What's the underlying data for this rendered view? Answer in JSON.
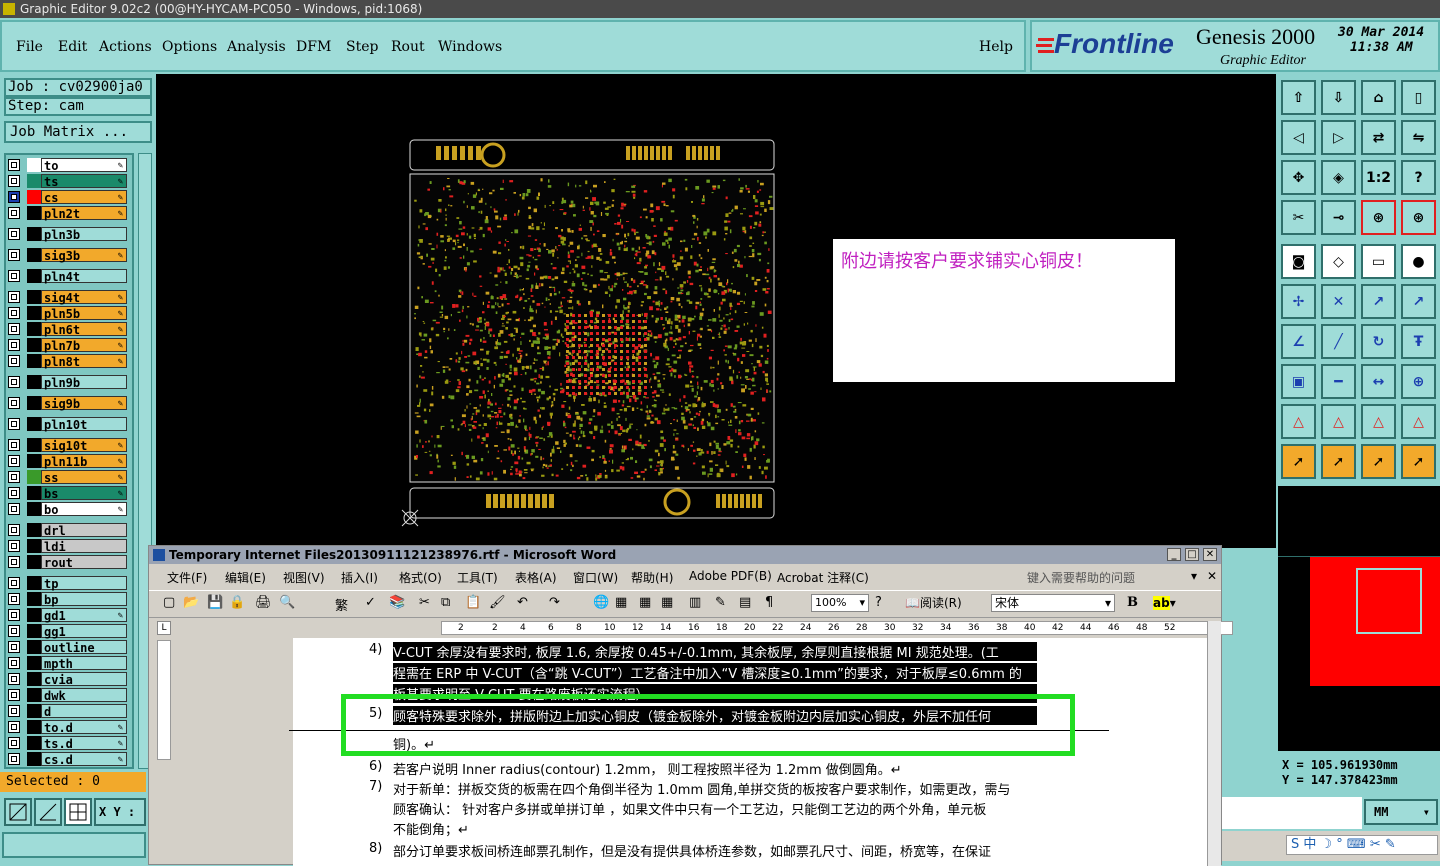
{
  "window": {
    "title": "Graphic Editor 9.02c2 (00@HY-HYCAM-PC050 - Windows, pid:1068)"
  },
  "menu": [
    "File",
    "Edit",
    "Actions",
    "Options",
    "Analysis",
    "DFM",
    "Step",
    "Rout",
    "Windows"
  ],
  "help": "Help",
  "brand": {
    "logo": "Frontline",
    "product": "Genesis 2000",
    "subtitle": "Graphic Editor",
    "date": "30 Mar 2014",
    "time": "11:38 AM"
  },
  "job": {
    "job_label": "Job : cv02900ja0",
    "step_label": "Step: cam",
    "matrix_button": "Job Matrix ..."
  },
  "layers": [
    {
      "name": "to",
      "color": "#ffffff",
      "name_bg": "#ffffff"
    },
    {
      "name": "ts",
      "color": "#1a8a6a",
      "name_bg": "#1a8a6a"
    },
    {
      "name": "cs",
      "color": "#ff0000",
      "name_bg": "#f2a92b",
      "active": true
    },
    {
      "name": "pln2t",
      "color": "#000000",
      "name_bg": "#f2a92b"
    },
    {
      "name": "pln3b",
      "color": "#000000",
      "name_bg": "#9fdcd8"
    },
    {
      "name": "sig3b",
      "color": "#000000",
      "name_bg": "#f2a92b"
    },
    {
      "name": "pln4t",
      "color": "#000000",
      "name_bg": "#9fdcd8"
    },
    {
      "name": "sig4t",
      "color": "#000000",
      "name_bg": "#f2a92b"
    },
    {
      "name": "pln5b",
      "color": "#000000",
      "name_bg": "#f2a92b"
    },
    {
      "name": "pln6t",
      "color": "#000000",
      "name_bg": "#f2a92b"
    },
    {
      "name": "pln7b",
      "color": "#000000",
      "name_bg": "#f2a92b"
    },
    {
      "name": "pln8t",
      "color": "#000000",
      "name_bg": "#f2a92b"
    },
    {
      "name": "pln9b",
      "color": "#000000",
      "name_bg": "#9fdcd8"
    },
    {
      "name": "sig9b",
      "color": "#000000",
      "name_bg": "#f2a92b"
    },
    {
      "name": "pln10t",
      "color": "#000000",
      "name_bg": "#9fdcd8"
    },
    {
      "name": "sig10t",
      "color": "#000000",
      "name_bg": "#f2a92b"
    },
    {
      "name": "pln11b",
      "color": "#000000",
      "name_bg": "#f2a92b"
    },
    {
      "name": "ss",
      "color": "#3a9a2a",
      "name_bg": "#f2a92b"
    },
    {
      "name": "bs",
      "color": "#000000",
      "name_bg": "#1a8a6a"
    },
    {
      "name": "bo",
      "color": "#000000",
      "name_bg": "#ffffff"
    },
    {
      "name": "drl",
      "color": "#000000",
      "name_bg": "#c8c8c8"
    },
    {
      "name": "ldi",
      "color": "#000000",
      "name_bg": "#c8c8c8"
    },
    {
      "name": "rout",
      "color": "#000000",
      "name_bg": "#c8c8c8"
    },
    {
      "name": "tp",
      "color": "#000000",
      "name_bg": "#9fdcd8"
    },
    {
      "name": "bp",
      "color": "#000000",
      "name_bg": "#9fdcd8"
    },
    {
      "name": "gd1",
      "color": "#000000",
      "name_bg": "#9fdcd8"
    },
    {
      "name": "gg1",
      "color": "#000000",
      "name_bg": "#9fdcd8"
    },
    {
      "name": "outline",
      "color": "#000000",
      "name_bg": "#9fdcd8"
    },
    {
      "name": "mpth",
      "color": "#000000",
      "name_bg": "#9fdcd8"
    },
    {
      "name": "cvia",
      "color": "#000000",
      "name_bg": "#9fdcd8"
    },
    {
      "name": "dwk",
      "color": "#000000",
      "name_bg": "#9fdcd8"
    },
    {
      "name": "d",
      "color": "#000000",
      "name_bg": "#9fdcd8"
    },
    {
      "name": "to.d",
      "color": "#000000",
      "name_bg": "#9fdcd8"
    },
    {
      "name": "ts.d",
      "color": "#000000",
      "name_bg": "#9fdcd8"
    },
    {
      "name": "cs.d",
      "color": "#000000",
      "name_bg": "#9fdcd8"
    }
  ],
  "selected": "Selected : 0",
  "xy_label": "X Y :",
  "note": "附边请按客户要求铺实心铜皮！",
  "coords": {
    "x": "X  =  105.961930mm",
    "y": "Y  =  147.378423mm"
  },
  "units": "MM",
  "word": {
    "title": "Temporary Internet Files20130911121238976.rtf - Microsoft Word",
    "menu": [
      "文件(F)",
      "编辑(E)",
      "视图(V)",
      "插入(I)",
      "格式(O)",
      "工具(T)",
      "表格(A)",
      "窗口(W)",
      "帮助(H)",
      "Adobe PDF(B)",
      "Acrobat 注释(C)"
    ],
    "help_placeholder": "键入需要帮助的问题",
    "zoom": "100%",
    "read_button": "阅读(R)",
    "font": "宋体",
    "ruler_marks": [
      "2",
      "2",
      "4",
      "6",
      "8",
      "10",
      "12",
      "14",
      "16",
      "18",
      "20",
      "22",
      "24",
      "26",
      "28",
      "30",
      "32",
      "34",
      "36",
      "38",
      "40",
      "42",
      "44",
      "46",
      "48",
      "52"
    ],
    "lines": [
      {
        "num": "4)",
        "text": "V-CUT 余厚没有要求时, 板厚 1.6, 余厚按 0.45+/-0.1mm, 其余板厚, 余厚则直接根据 MI 规范处理。(工"
      },
      {
        "num": "",
        "text": "程需在 ERP 中 V-CUT（含“跳 V-CUT”）工艺备注中加入“V 槽深度≥0.1mm”的要求，对于板厚≤0.6mm 的"
      },
      {
        "num": "",
        "text": "板甚要求明至 V-CUT 要在路废板还实流程）"
      },
      {
        "num": "5)",
        "text": "顾客特殊要求除外，拼版附边上加实心铜皮（镀金板除外，对镀金板附边内层加实心铜皮，外层不加任何"
      },
      {
        "num": "",
        "text": "铜)。↵"
      },
      {
        "num": "6)",
        "text": "若客户说明 Inner radius(contour) 1.2mm，    则工程按照半径为 1.2mm 做倒圆角。↵"
      },
      {
        "num": "7)",
        "text": "对于新单：拼板交货的板需在四个角倒半径为 1.0mm 圆角,单拼交货的板按客户要求制作，如需更改，需与"
      },
      {
        "num": "",
        "text": "顾客确认：  针对客户多拼或单拼订单 ，如果文件中只有一个工艺边，只能倒工艺边的两个外角，单元板"
      },
      {
        "num": "",
        "text": "不能倒角；↵"
      },
      {
        "num": "8)",
        "text": "部分订单要求板间桥连邮票孔制作，但是没有提供具体桥连参数，如邮票孔尺寸、间距，桥宽等，在保证"
      }
    ]
  },
  "colors": {
    "panel": "#9fdcd8",
    "orange": "#f2a92b",
    "highlight": "#22dd22",
    "pcb_red": "#e02020",
    "pcb_green": "#6a9a20",
    "pcb_gold": "#c8a020"
  }
}
